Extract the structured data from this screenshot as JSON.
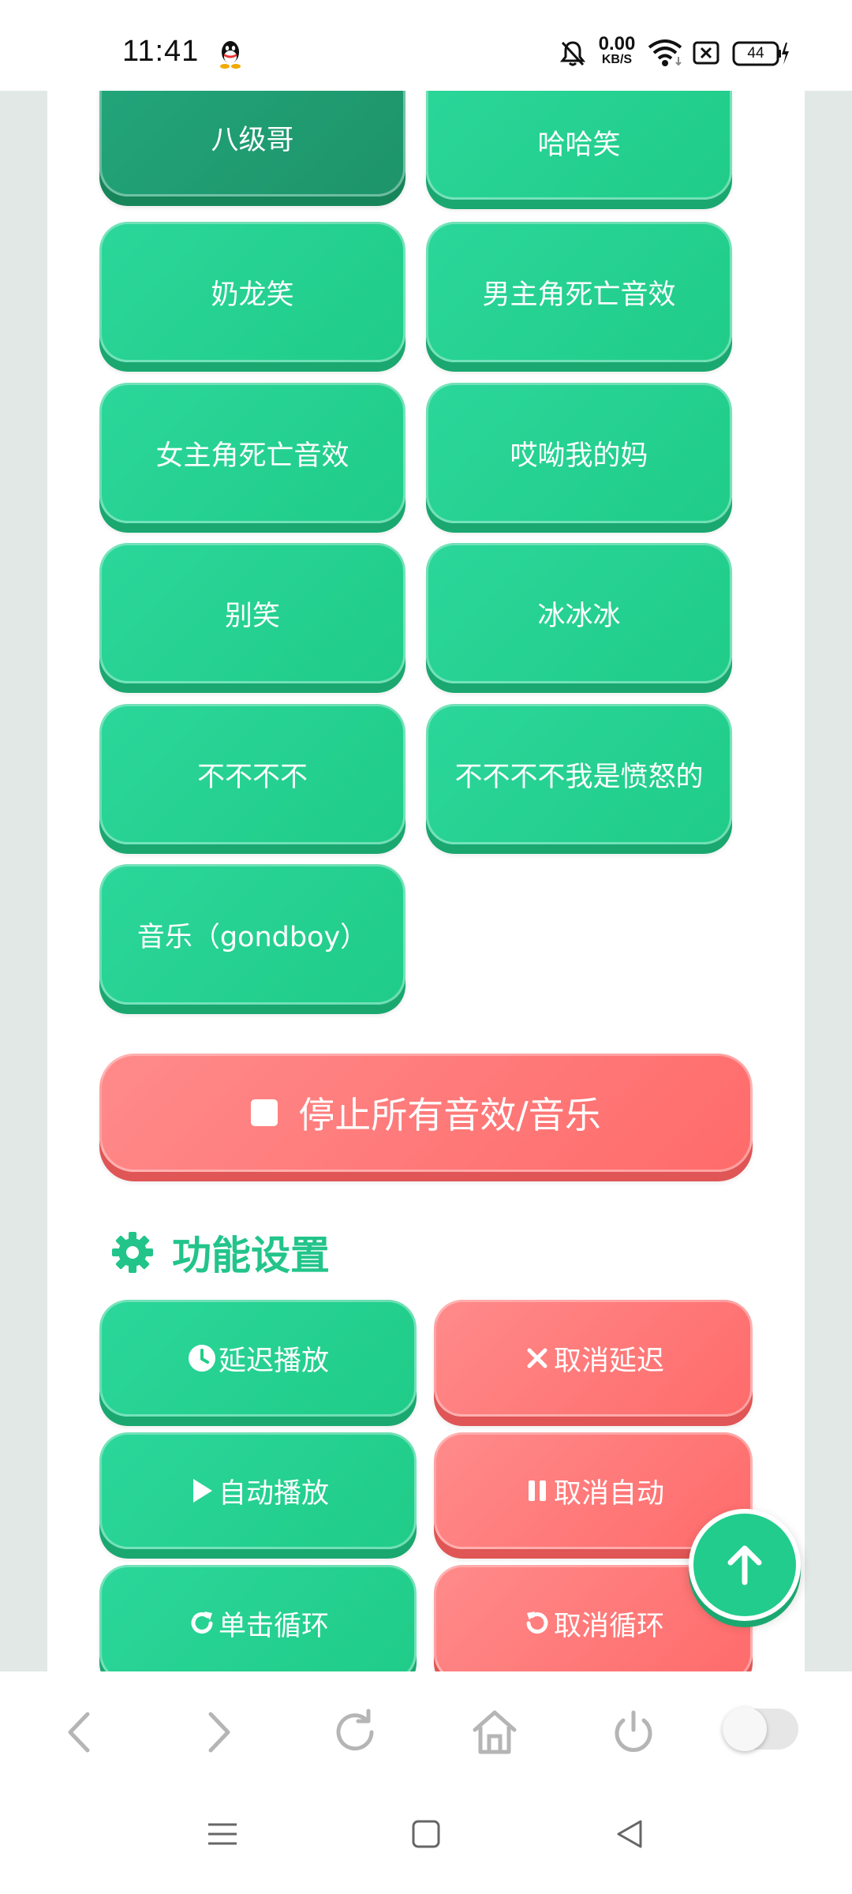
{
  "status_bar": {
    "time": "11:41",
    "net_speed_value": "0.00",
    "net_speed_unit": "KB/S",
    "battery": "44",
    "icons": [
      "qq-icon",
      "mute-icon",
      "wifi-icon",
      "sim-icon",
      "battery-icon",
      "charging-icon"
    ]
  },
  "sound_buttons": [
    {
      "label": "八级哥",
      "state": "pressed"
    },
    {
      "label": "哈哈笑"
    },
    {
      "label": "奶龙笑"
    },
    {
      "label": "男主角死亡音效"
    },
    {
      "label": "女主角死亡音效"
    },
    {
      "label": "哎呦我的妈"
    },
    {
      "label": "别笑"
    },
    {
      "label": "冰冰冰"
    },
    {
      "label": "不不不不"
    },
    {
      "label": "不不不不我是愤怒的"
    },
    {
      "label": "音乐（gondboy）"
    }
  ],
  "stop_button": {
    "label": "停止所有音效/音乐",
    "icon": "stop-icon"
  },
  "settings": {
    "title": "功能设置",
    "icon": "gear-icon",
    "buttons": [
      {
        "label": "延迟播放",
        "icon": "clock-icon",
        "color": "green"
      },
      {
        "label": "取消延迟",
        "icon": "times-icon",
        "color": "red"
      },
      {
        "label": "自动播放",
        "icon": "play-icon",
        "color": "green"
      },
      {
        "label": "取消自动",
        "icon": "pause-icon",
        "color": "red"
      },
      {
        "label": "单击循环",
        "icon": "redo-icon",
        "color": "green"
      },
      {
        "label": "取消循环",
        "icon": "undo-icon",
        "color": "red"
      }
    ]
  },
  "browser_bar": {
    "icons": [
      "back-icon",
      "forward-icon",
      "refresh-icon",
      "home-icon",
      "power-icon"
    ],
    "toggle_on": false
  },
  "nav_bar": {
    "icons": [
      "menu-icon",
      "home-square-icon",
      "back-triangle-icon"
    ]
  },
  "colors": {
    "green": "#22cc8c",
    "red": "#ff6b6b",
    "accent_title": "#22c48a"
  }
}
